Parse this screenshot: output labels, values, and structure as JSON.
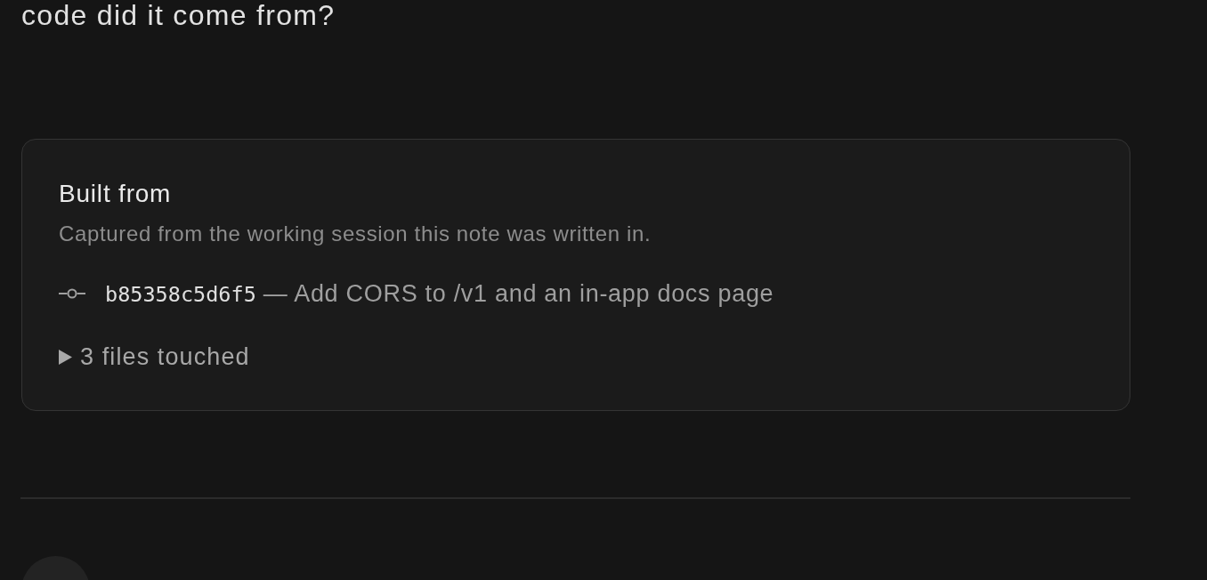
{
  "heading": {
    "text": "code did it come from?"
  },
  "built_from": {
    "title": "Built from",
    "subtitle": "Captured from the working session this note was written in.",
    "commit": {
      "hash": "b85358c5d6f5",
      "message": "— Add CORS to /v1 and an in-app docs page"
    },
    "files": {
      "label": "3 files touched",
      "expanded": false
    }
  }
}
